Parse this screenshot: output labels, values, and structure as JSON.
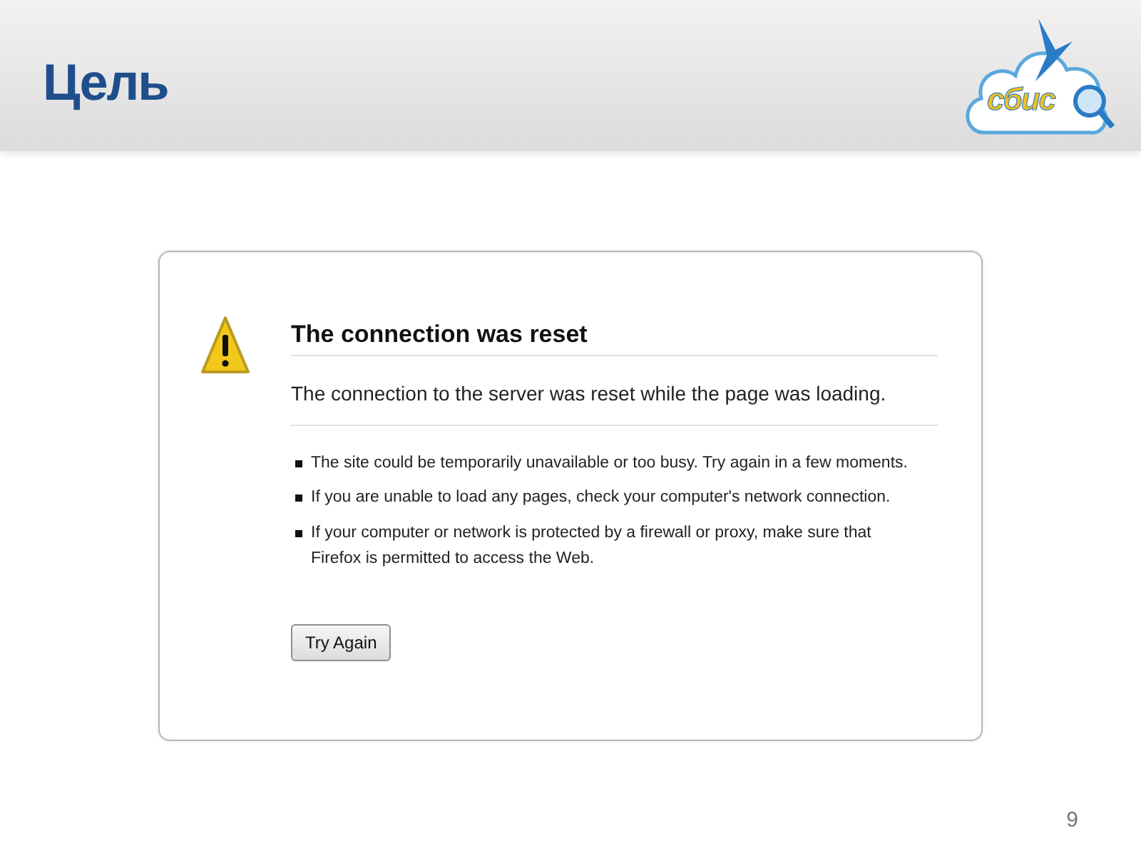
{
  "slide": {
    "title": "Цель",
    "logo_text": "сбис",
    "page_number": "9"
  },
  "error_page": {
    "title": "The connection was reset",
    "description": "The connection to the server was reset while the page was loading.",
    "suggestions": [
      "The site could be temporarily unavailable or too busy. Try again in a few moments.",
      "If you are unable to load any pages, check your computer's network connection.",
      "If your computer or network is protected by a firewall or proxy, make sure that Firefox is permitted to access the Web."
    ],
    "button": "Try Again"
  }
}
